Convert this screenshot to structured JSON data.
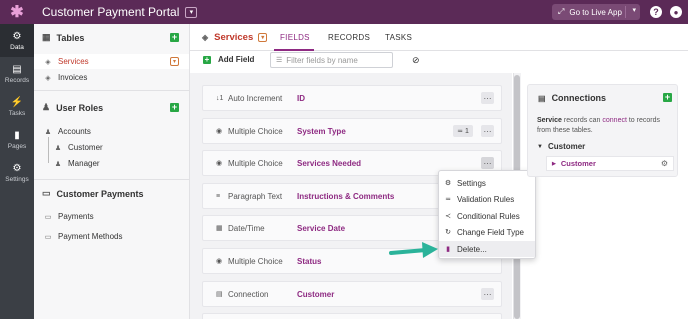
{
  "app": {
    "title": "Customer Payment Portal",
    "title_dropdown": "▾",
    "live_button": "Go to Live App",
    "live_icon": "⤢",
    "live_dropdown": "▾",
    "help": "?",
    "user": "●",
    "colors": {
      "brand": "#5b2a57",
      "accent": "#8e2a82",
      "add": "#28a745",
      "active": "#c0392b"
    }
  },
  "rail": [
    {
      "label": "Data",
      "icon": "database-icon",
      "glyph": "⚙"
    },
    {
      "label": "Records",
      "icon": "records-icon",
      "glyph": "▤"
    },
    {
      "label": "Tasks",
      "icon": "tasks-icon",
      "glyph": "⚡"
    },
    {
      "label": "Pages",
      "icon": "pages-icon",
      "glyph": "▮"
    },
    {
      "label": "Settings",
      "icon": "settings-icon",
      "glyph": "⚙"
    }
  ],
  "sidebar": {
    "tables": {
      "title": "Tables",
      "items": [
        {
          "label": "Services",
          "active": true
        },
        {
          "label": "Invoices"
        }
      ]
    },
    "roles": {
      "title": "User Roles",
      "items": [
        {
          "label": "Accounts"
        },
        {
          "label": "Customer"
        },
        {
          "label": "Manager"
        }
      ]
    },
    "payments": {
      "title": "Customer Payments",
      "items": [
        {
          "label": "Payments"
        },
        {
          "label": "Payment Methods"
        }
      ]
    },
    "add": "+"
  },
  "header": {
    "title": "Services",
    "tabs": [
      {
        "label": "FIELDS",
        "active": true
      },
      {
        "label": "RECORDS"
      },
      {
        "label": "TASKS"
      }
    ]
  },
  "toolbar": {
    "add_field": "Add Field",
    "filter_placeholder": "Filter fields by name"
  },
  "fields": [
    {
      "type": "Auto Increment",
      "name": "ID",
      "icon": "auto-increment-icon",
      "glyph": "↓1"
    },
    {
      "type": "Multiple Choice",
      "name": "System Type",
      "icon": "multiple-choice-icon",
      "glyph": "◉",
      "count": "1"
    },
    {
      "type": "Multiple Choice",
      "name": "Services Needed",
      "icon": "multiple-choice-icon",
      "glyph": "◉"
    },
    {
      "type": "Paragraph Text",
      "name": "Instructions & Comments",
      "icon": "paragraph-icon",
      "glyph": "≡"
    },
    {
      "type": "Date/Time",
      "name": "Service Date",
      "icon": "calendar-icon",
      "glyph": "▦"
    },
    {
      "type": "Multiple Choice",
      "name": "Status",
      "icon": "multiple-choice-icon",
      "glyph": "◉"
    },
    {
      "type": "Connection",
      "name": "Customer",
      "icon": "connection-icon",
      "glyph": "▤"
    }
  ],
  "more": "···",
  "menu": [
    {
      "label": "Settings",
      "icon": "gear-icon",
      "glyph": "⚙"
    },
    {
      "label": "Validation Rules",
      "icon": "validation-icon",
      "glyph": "≂"
    },
    {
      "label": "Conditional Rules",
      "icon": "conditional-icon",
      "glyph": "≺"
    },
    {
      "label": "Change Field Type",
      "icon": "change-type-icon",
      "glyph": "↻"
    },
    {
      "label": "Delete...",
      "icon": "trash-icon",
      "glyph": "▮",
      "highlighted": true
    }
  ],
  "connections": {
    "title": "Connections",
    "desc_strong": "Service",
    "desc_1": " records can ",
    "desc_link": "connect",
    "desc_2": " to records from these tables.",
    "group": "Customer",
    "item": "Customer"
  }
}
